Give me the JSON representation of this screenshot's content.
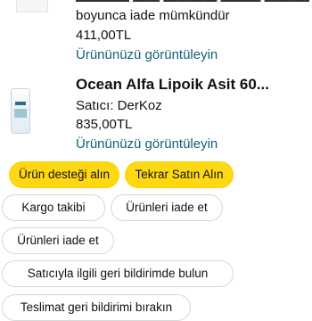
{
  "order_items": [
    {
      "title_top": "",
      "description": "boyunca iade mümkündür",
      "price": "411,00TL",
      "review_link": "Ürününüzü görüntüleyin"
    },
    {
      "title": "Ocean Alfa Lipoik Asit 60...",
      "seller": "Satıcı: DerKoz",
      "price": "835,00TL",
      "review_link": "Ürününüzü görüntüleyin"
    }
  ],
  "actions": {
    "support_label": "Ürün desteği alın",
    "buy_again_label": "Tekrar Satın Alın",
    "track_label": "Kargo takibi",
    "return_label": "Ürünleri iade et",
    "return_label_2": "Ürünleri iade et",
    "feedback_label": "Satıcıyla ilgili geri bildirimde bulun",
    "delivery_feedback_label": "Teslimat geri bildirimi bırakın"
  },
  "colors": {
    "primary_button": "#ffd814",
    "link": "#0f5f79",
    "outline": "#d5d9d9"
  }
}
